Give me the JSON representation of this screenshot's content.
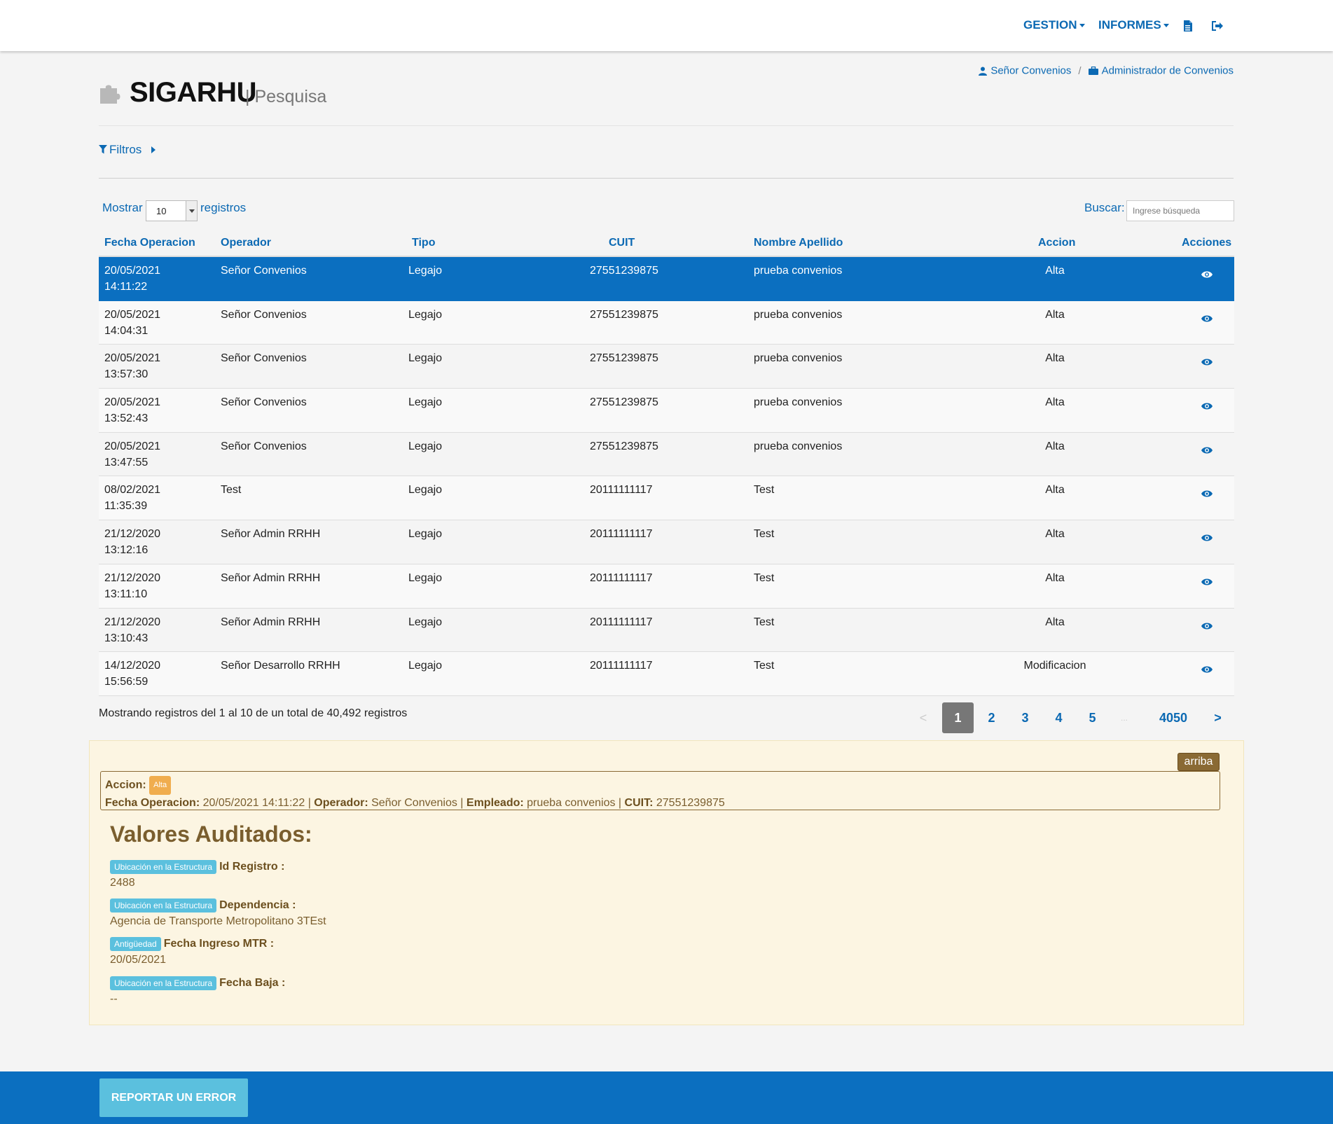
{
  "nav": {
    "gestion": "GESTION",
    "informes": "INFORMES",
    "doc_icon": "file-icon",
    "logout_icon": "sign-out-icon"
  },
  "breadcrumb": {
    "user": "Señor Convenios",
    "separator": "/",
    "role": "Administrador de Convenios"
  },
  "header": {
    "title": "SIGARHU",
    "subtitle": "| Pesquisa",
    "filters": "Filtros"
  },
  "table_controls": {
    "show_label": "Mostrar",
    "show_value": "10",
    "show_suffix": "registros",
    "search_label": "Buscar:",
    "search_placeholder": "Ingrese búsqueda"
  },
  "table": {
    "headers": [
      "Fecha Operacion",
      "Operador",
      "Tipo",
      "CUIT",
      "Nombre Apellido",
      "Accion",
      "Acciones"
    ],
    "rows": [
      {
        "date": "20/05/2021",
        "time": "14:11:22",
        "operador": "Señor Convenios",
        "tipo": "Legajo",
        "cuit": "27551239875",
        "nombre": "prueba convenios",
        "accion": "Alta"
      },
      {
        "date": "20/05/2021",
        "time": "14:04:31",
        "operador": "Señor Convenios",
        "tipo": "Legajo",
        "cuit": "27551239875",
        "nombre": "prueba convenios",
        "accion": "Alta"
      },
      {
        "date": "20/05/2021",
        "time": "13:57:30",
        "operador": "Señor Convenios",
        "tipo": "Legajo",
        "cuit": "27551239875",
        "nombre": "prueba convenios",
        "accion": "Alta"
      },
      {
        "date": "20/05/2021",
        "time": "13:52:43",
        "operador": "Señor Convenios",
        "tipo": "Legajo",
        "cuit": "27551239875",
        "nombre": "prueba convenios",
        "accion": "Alta"
      },
      {
        "date": "20/05/2021",
        "time": "13:47:55",
        "operador": "Señor Convenios",
        "tipo": "Legajo",
        "cuit": "27551239875",
        "nombre": "prueba convenios",
        "accion": "Alta"
      },
      {
        "date": "08/02/2021",
        "time": "11:35:39",
        "operador": "Test",
        "tipo": "Legajo",
        "cuit": "20111111117",
        "nombre": "Test",
        "accion": "Alta"
      },
      {
        "date": "21/12/2020",
        "time": "13:12:16",
        "operador": "Señor Admin RRHH",
        "tipo": "Legajo",
        "cuit": "20111111117",
        "nombre": "Test",
        "accion": "Alta"
      },
      {
        "date": "21/12/2020",
        "time": "13:11:10",
        "operador": "Señor Admin RRHH",
        "tipo": "Legajo",
        "cuit": "20111111117",
        "nombre": "Test",
        "accion": "Alta"
      },
      {
        "date": "21/12/2020",
        "time": "13:10:43",
        "operador": "Señor Admin RRHH",
        "tipo": "Legajo",
        "cuit": "20111111117",
        "nombre": "Test",
        "accion": "Alta"
      },
      {
        "date": "14/12/2020",
        "time": "15:56:59",
        "operador": "Señor Desarrollo RRHH",
        "tipo": "Legajo",
        "cuit": "20111111117",
        "nombre": "Test",
        "accion": "Modificacion"
      }
    ],
    "selected_row": 0,
    "action_icon": "eye-icon"
  },
  "pagination": {
    "info": "Mostrando registros del 1 al 10 de un total de 40,492 registros",
    "prev": "<",
    "pages": [
      "1",
      "2",
      "3",
      "4",
      "5"
    ],
    "ellipsis": "...",
    "last": "4050",
    "next": ">",
    "active_page": "1"
  },
  "detail": {
    "top_button": "arriba",
    "accion_label": "Accion:",
    "accion_badge": "Alta",
    "fecha_label": "Fecha Operacion:",
    "fecha_value": "20/05/2021 14:11:22",
    "operador_label": "Operador:",
    "operador_value": "Señor Convenios",
    "empleado_label": "Empleado:",
    "empleado_value": "prueba convenios",
    "cuit_label": "CUIT:",
    "cuit_value": "27551239875",
    "sep": "|",
    "section_title": "Valores Auditados:",
    "fields": [
      {
        "badge": "Ubicación en la Estructura",
        "name": "Id Registro :",
        "value": "2488"
      },
      {
        "badge": "Ubicación en la Estructura",
        "name": "Dependencia :",
        "value": "Agencia de Transporte Metropolitano 3TEst"
      },
      {
        "badge": "Antigüedad",
        "name": "Fecha Ingreso MTR :",
        "value": "20/05/2021"
      },
      {
        "badge": "Ubicación en la Estructura",
        "name": "Fecha Baja :",
        "value": "--"
      }
    ]
  },
  "footer": {
    "report_button": "REPORTAR UN ERROR"
  },
  "colors": {
    "primary": "#0b69b3",
    "selected_row": "#0b6fc0",
    "panel_bg": "#fcf5e2",
    "panel_text": "#7a5e2e",
    "badge_blue": "#5bc0de",
    "badge_orange": "#f0ad4e"
  }
}
